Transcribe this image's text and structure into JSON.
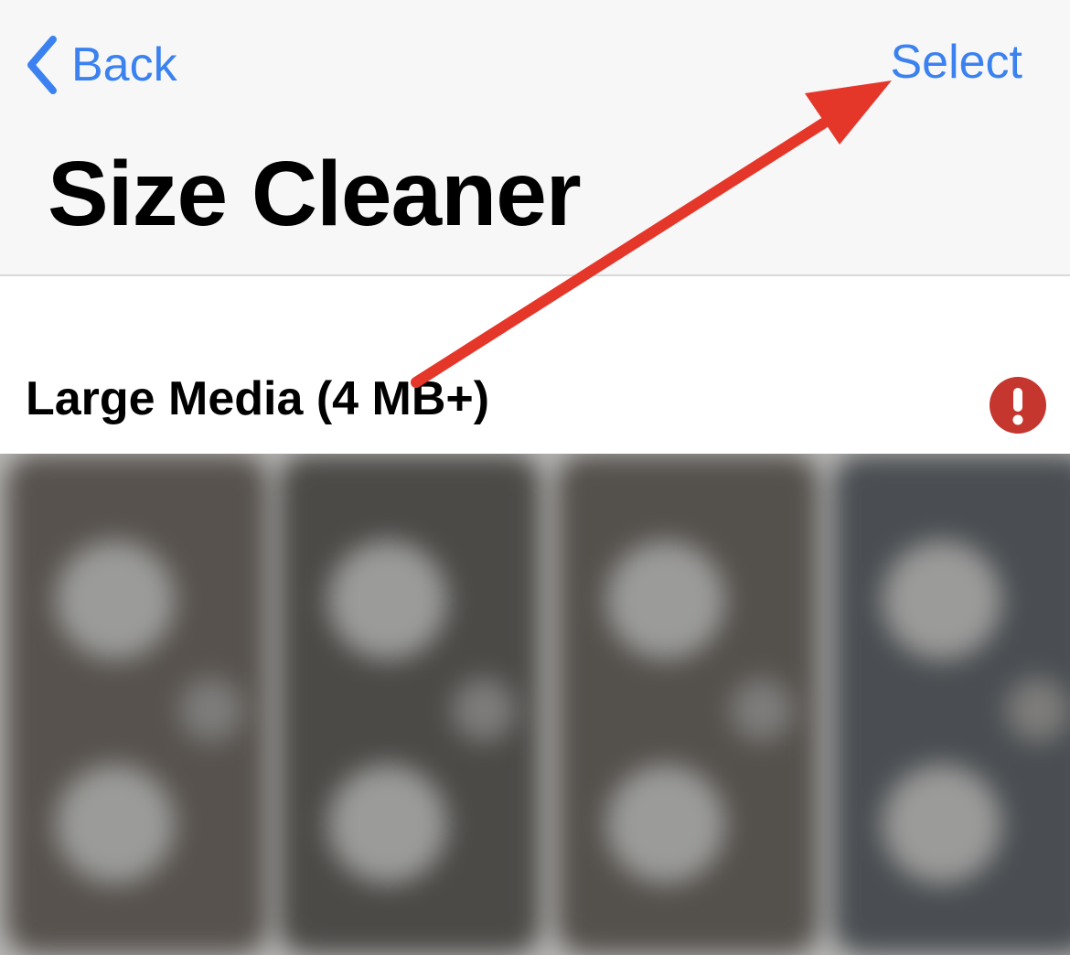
{
  "nav": {
    "back_label": "Back",
    "select_label": "Select",
    "title": "Size Cleaner"
  },
  "section": {
    "title": "Large Media (4 MB+)",
    "status_icon": "exclamation-circle-icon"
  },
  "media": {
    "thumbnails": [
      {
        "icon": "blurred-thumbnail"
      },
      {
        "icon": "blurred-thumbnail"
      },
      {
        "icon": "blurred-thumbnail"
      },
      {
        "icon": "blurred-thumbnail"
      }
    ]
  },
  "colors": {
    "accent": "#3b82f0",
    "warning": "#c4362e",
    "arrow": "#e5362a",
    "nav_background": "#f7f7f7"
  }
}
